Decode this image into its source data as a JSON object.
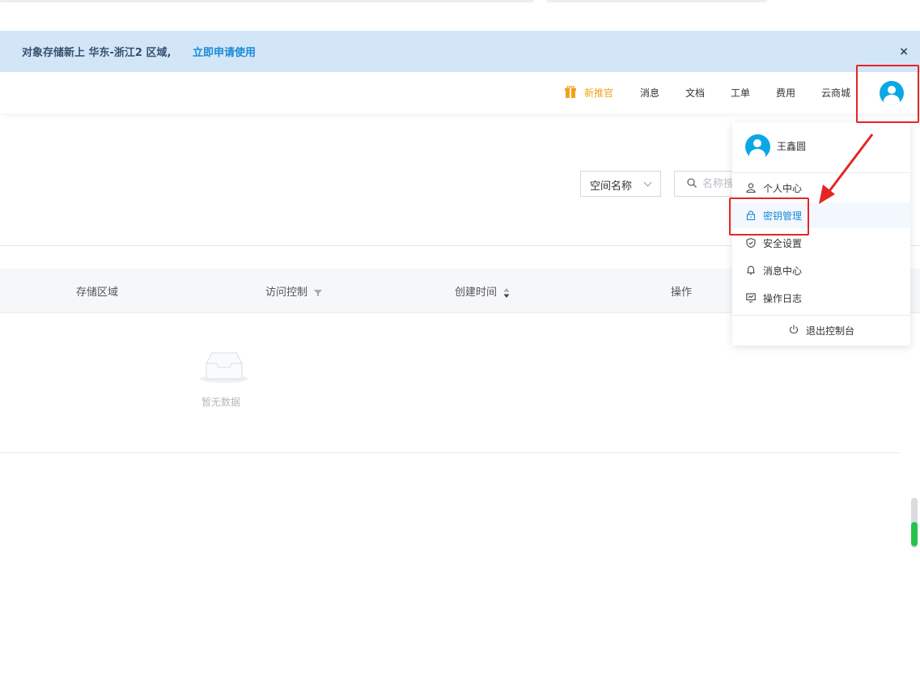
{
  "banner": {
    "text": "对象存储新上 华东-浙江2 区域,",
    "link": "立即申请使用",
    "close": "×"
  },
  "header": {
    "nav": {
      "promo": "新推官",
      "messages": "消息",
      "docs": "文档",
      "tickets": "工单",
      "billing": "费用",
      "market": "云商城"
    }
  },
  "filter": {
    "select_value": "空间名称",
    "search_placeholder": "名称搜"
  },
  "table": {
    "columns": {
      "region": "存储区域",
      "access": "访问控制",
      "created": "创建时间",
      "actions": "操作"
    },
    "empty_text": "暂无数据"
  },
  "user_menu": {
    "username": "王鑫圆",
    "items": [
      {
        "label": "个人中心",
        "icon": "user-icon",
        "active": false
      },
      {
        "label": "密钥管理",
        "icon": "lock-icon",
        "active": true
      },
      {
        "label": "安全设置",
        "icon": "shield-icon",
        "active": false
      },
      {
        "label": "消息中心",
        "icon": "bell-icon",
        "active": false
      },
      {
        "label": "操作日志",
        "icon": "monitor-log-icon",
        "active": false
      }
    ],
    "logout": "退出控制台"
  },
  "colors": {
    "accent": "#1a8ad6",
    "banner_bg": "#d3e6f8",
    "promo": "#f2a21a",
    "annotation": "#e52626"
  }
}
